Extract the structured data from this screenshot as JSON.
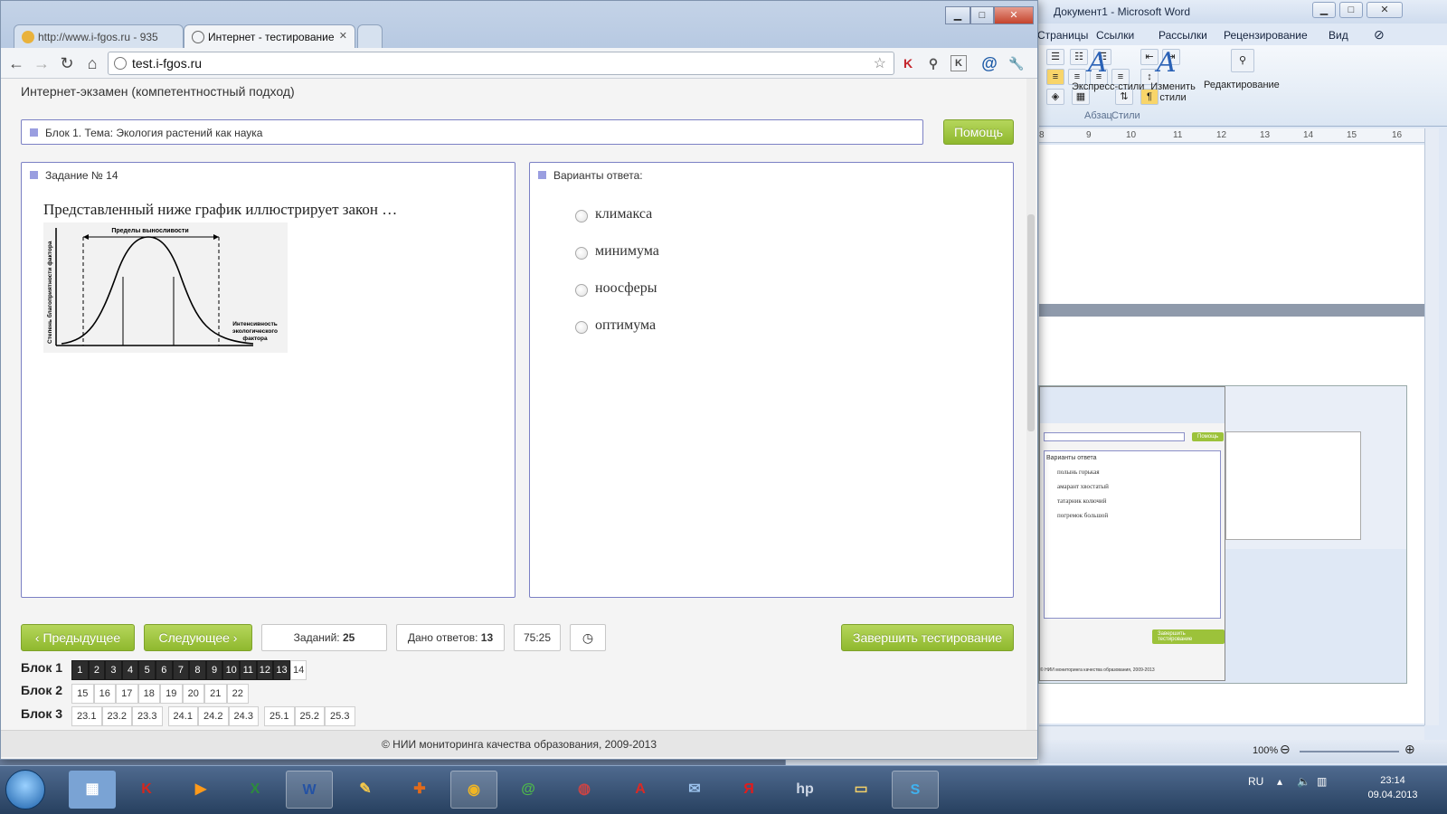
{
  "word": {
    "title": "Документ1 - Microsoft Word",
    "tabs": [
      "Страницы",
      "Ссылки",
      "Рассылки",
      "Рецензирование",
      "Вид"
    ],
    "groups": {
      "paragraph": "Абзац",
      "styles": "Стили"
    },
    "express_styles": "Экспресс-стили",
    "change_styles": "Изменить стили",
    "editing": "Редактирование",
    "ruler": [
      "8",
      "9",
      "10",
      "11",
      "12",
      "13",
      "14",
      "15",
      "16"
    ],
    "zoom": "100%",
    "nested": {
      "help": "Помощь",
      "answers_head": "Варианты ответа",
      "answers": [
        "полынь горькая",
        "амарант хвостатый",
        "татарник колючий",
        "погремок большой"
      ],
      "finish": "Завершить тестирование",
      "footer": "© НИИ мониторинга качества образования, 2009-2013"
    }
  },
  "browser": {
    "tabs": [
      {
        "label": "http://www.i-fgos.ru - 935",
        "active": false
      },
      {
        "label": "Интернет - тестирование",
        "active": true
      }
    ],
    "url": "test.i-fgos.ru",
    "controls": {
      "min": "▁",
      "max": "□",
      "close": "✕"
    }
  },
  "page": {
    "title": "Интернет-экзамен (компетентностный подход)",
    "topic": "Блок 1. Тема: Экология растений как наука",
    "help_label": "Помощь",
    "task_label": "Задание № 14",
    "question": "Представленный ниже график иллюстрирует закон …",
    "graph": {
      "limits_label": "Пределы выносливости",
      "y_label": "Степень благоприятности фактора",
      "x_label_1": "Интенсивность",
      "x_label_2": "экологического",
      "x_label_3": "фактора"
    },
    "answers_label": "Варианты ответа:",
    "answers": [
      "климакса",
      "минимума",
      "ноосферы",
      "оптимума"
    ],
    "prev_label": "Предыдущее",
    "next_label": "Следующее",
    "tasks_label": "Заданий:",
    "tasks_count": "25",
    "answered_label": "Дано ответов:",
    "answered_count": "13",
    "timer": "75:25",
    "finish_label": "Завершить тестирование",
    "blocks": [
      {
        "label": "Блок 1",
        "items": [
          "1",
          "2",
          "3",
          "4",
          "5",
          "6",
          "7",
          "8",
          "9",
          "10",
          "11",
          "12",
          "13",
          "14"
        ],
        "done_count": 13
      },
      {
        "label": "Блок 2",
        "items": [
          "15",
          "16",
          "17",
          "18",
          "19",
          "20",
          "21",
          "22"
        ],
        "done_count": 0
      },
      {
        "label": "Блок 3",
        "items": [
          "23.1",
          "23.2",
          "23.3",
          "24.1",
          "24.2",
          "24.3",
          "25.1",
          "25.2",
          "25.3"
        ],
        "done_count": 0
      }
    ],
    "footer": "© НИИ мониторинга качества образования, 2009-2013"
  },
  "taskbar": {
    "lang": "RU",
    "time": "23:14",
    "date": "09.04.2013"
  },
  "colors": {
    "accent_green": "#9cc23a",
    "panel_border": "#7b80c4",
    "done_box": "#2d2d2d"
  }
}
